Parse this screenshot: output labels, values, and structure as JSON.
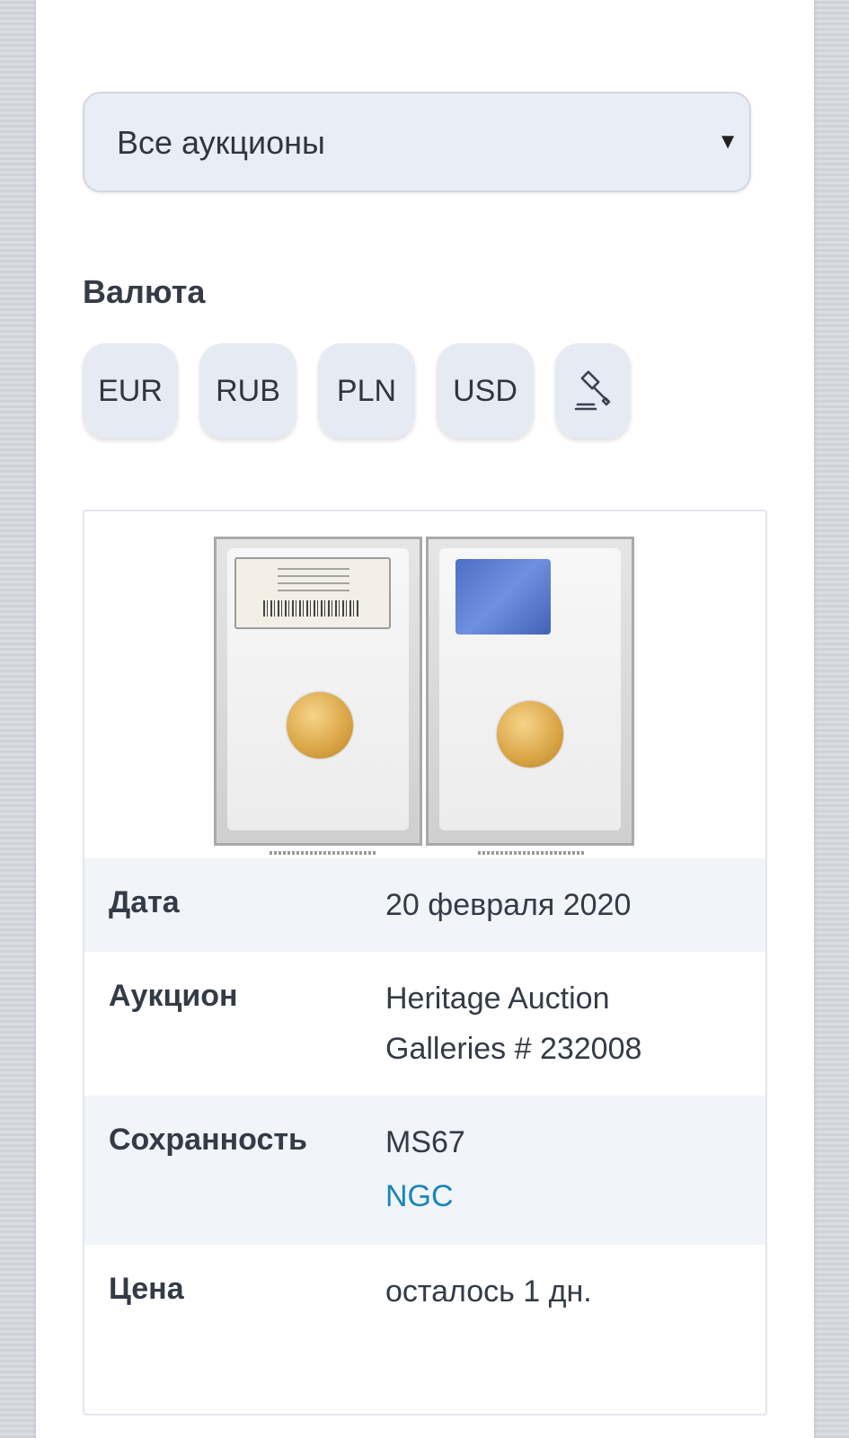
{
  "auction_select": {
    "value": "Все аукционы",
    "arrow": "▼"
  },
  "currency_section": {
    "label": "Валюта",
    "chips": [
      "EUR",
      "RUB",
      "PLN",
      "USD"
    ],
    "extra_icon": "gavel-icon"
  },
  "lot": {
    "rows": [
      {
        "label": "Дата",
        "value": "20 февраля 2020"
      },
      {
        "label": "Аукцион",
        "value": "Heritage Auction Galleries # 232008"
      },
      {
        "label": "Сохранность",
        "value": "MS67",
        "link": "NGC"
      },
      {
        "label": "Цена",
        "value": "осталось 1 дн."
      }
    ]
  },
  "colors": {
    "accent_link": "#1a86b8",
    "chip_bg": "#e6eaf3",
    "row_alt_bg": "#f1f4f9"
  }
}
